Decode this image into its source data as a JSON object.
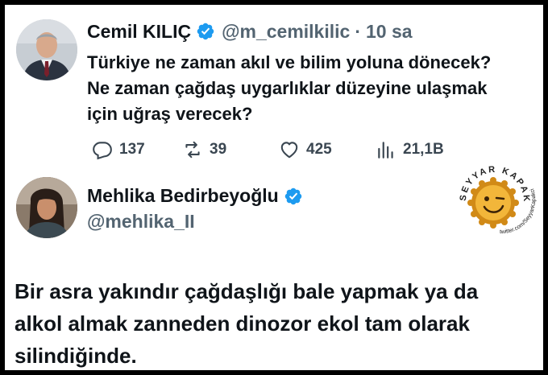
{
  "tweet1": {
    "author_name": "Cemil KILIÇ",
    "handle": "@m_cemilkilic",
    "separator": "·",
    "time": "10 sa",
    "text": "Türkiye ne zaman akıl ve bilim yoluna dönecek? Ne zaman çağdaş uygarlıklar düzeyine ulaşmak için uğraş verecek?",
    "actions": {
      "replies": "137",
      "retweets": "39",
      "likes": "425",
      "views": "21,1B"
    },
    "icons": [
      "verified-icon",
      "reply-icon",
      "retweet-icon",
      "like-icon",
      "views-icon"
    ]
  },
  "tweet2": {
    "author_name": "Mehlika Bedirbeyoğlu",
    "handle": "@mehlika_II",
    "text": "Bir asra yakındır çağdaşlığı bale yapmak ya da alkol almak zanneden dinozor ekol tam olarak silindiğinde."
  },
  "watermark": {
    "arc_text": "SEYYAR KAPAKCI",
    "url_text": "twitter.com/SeyyarKapakci"
  },
  "colors": {
    "verified": "#1d9bf0",
    "text": "#0f1419",
    "muted": "#536471",
    "cap_gold": "#e9a62a"
  }
}
